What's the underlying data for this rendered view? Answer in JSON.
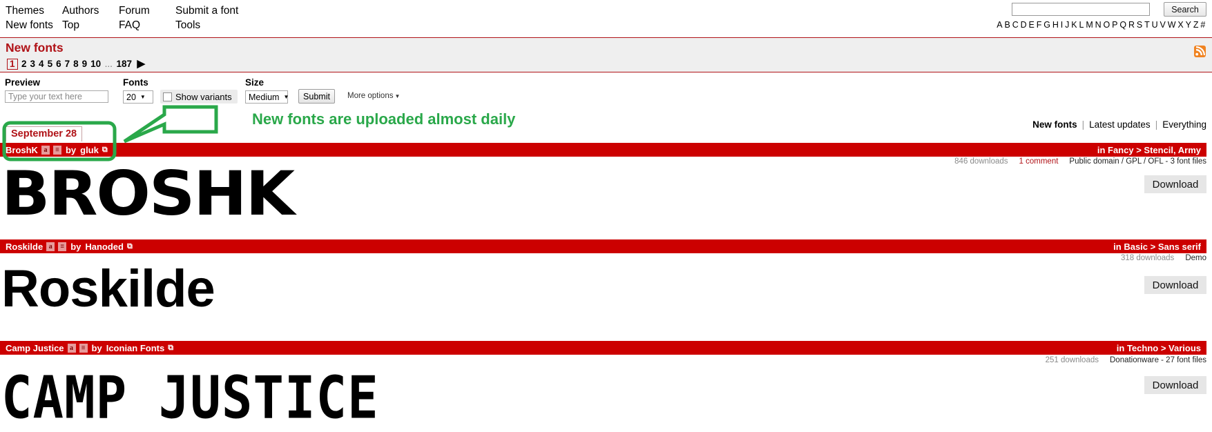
{
  "nav": {
    "columns": [
      {
        "top": "Themes",
        "bottom": "New fonts"
      },
      {
        "top": "Authors",
        "bottom": "Top"
      },
      {
        "top": "Forum",
        "bottom": "FAQ"
      },
      {
        "top": "Submit a font",
        "bottom": "Tools"
      }
    ]
  },
  "search": {
    "value": "",
    "placeholder": "",
    "button_label": "Search"
  },
  "alphabet": [
    "A",
    "B",
    "C",
    "D",
    "E",
    "F",
    "G",
    "H",
    "I",
    "J",
    "K",
    "L",
    "M",
    "N",
    "O",
    "P",
    "Q",
    "R",
    "S",
    "T",
    "U",
    "V",
    "W",
    "X",
    "Y",
    "Z",
    "#"
  ],
  "section": {
    "title": "New fonts",
    "rss_label": "rss-feed"
  },
  "pagination": {
    "current": "1",
    "pages": [
      "2",
      "3",
      "4",
      "5",
      "6",
      "7",
      "8",
      "9",
      "10"
    ],
    "ellipsis": "...",
    "last": "187",
    "next_glyph": "▶"
  },
  "controls": {
    "preview_label": "Preview",
    "preview_placeholder": "Type your text here",
    "preview_value": "",
    "fonts_label": "Fonts",
    "fonts_value": "20",
    "show_variants_label": "Show variants",
    "show_variants_checked": false,
    "size_label": "Size",
    "size_value": "Medium",
    "submit_label": "Submit",
    "more_options_label": "More options",
    "caret_glyph": "▼"
  },
  "filters": {
    "active": "New fonts",
    "latest": "Latest updates",
    "everything": "Everything",
    "separator": "|"
  },
  "date_header": "September 28",
  "annotation": {
    "text": "New fonts are uploaded almost daily",
    "color": "#2aa84a"
  },
  "colors": {
    "red_bar": "#cc0000",
    "brand_red": "#b01217",
    "download_button": "#e6e6e6",
    "rss_orange": "#f08321",
    "annotation_green": "#2aa84a"
  },
  "fonts": [
    {
      "name": "BroshK",
      "badge_a": "a",
      "badge_e": "≡",
      "by_label": "by",
      "author": "gluk",
      "external_glyph": "⧉",
      "category": "in Fancy > Stencil, Army",
      "downloads": "846 downloads",
      "comments": "1 comment",
      "license": "Public domain / GPL / OFL - 3 font files",
      "download_label": "Download",
      "specimen": "BROSHK"
    },
    {
      "name": "Roskilde",
      "badge_a": "a",
      "badge_e": "≡",
      "by_label": "by",
      "author": "Hanoded",
      "external_glyph": "⧉",
      "category": "in Basic > Sans serif",
      "downloads": "318 downloads",
      "comments": "",
      "license": "Demo",
      "download_label": "Download",
      "specimen": "Roskilde"
    },
    {
      "name": "Camp Justice",
      "badge_a": "a",
      "badge_e": "≡",
      "by_label": "by",
      "author": "Iconian Fonts",
      "external_glyph": "⧉",
      "category": "in Techno > Various",
      "downloads": "251 downloads",
      "comments": "",
      "license": "Donationware - 27 font files",
      "download_label": "Download",
      "specimen": "CAMP JUSTICE"
    }
  ]
}
